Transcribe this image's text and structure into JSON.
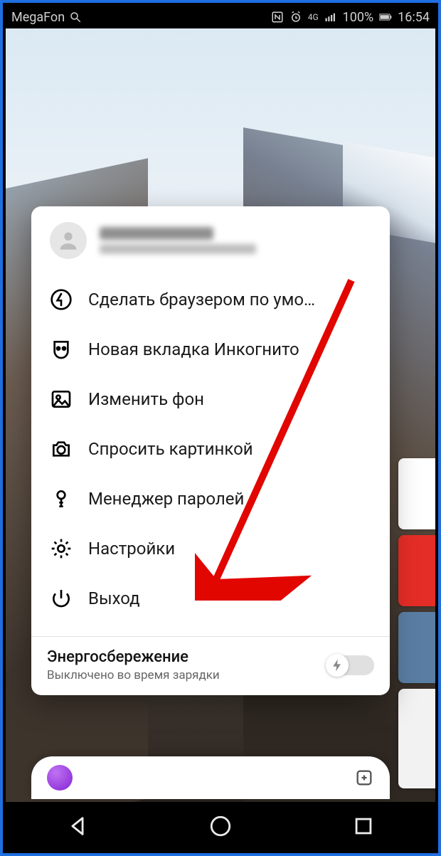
{
  "status": {
    "carrier": "MegaFon",
    "nfc_icon": "nfc-icon",
    "alarm_icon": "alarm-icon",
    "signal_label": "4G",
    "battery_pct": "100%",
    "time": "16:54"
  },
  "menu": {
    "items": [
      {
        "icon": "yandex-icon",
        "label": "Сделать браузером по умо…"
      },
      {
        "icon": "incognito-icon",
        "label": "Новая вкладка Инкогнито"
      },
      {
        "icon": "image-icon",
        "label": "Изменить фон"
      },
      {
        "icon": "camera-icon",
        "label": "Спросить картинкой"
      },
      {
        "icon": "key-icon",
        "label": "Менеджер паролей"
      },
      {
        "icon": "gear-icon",
        "label": "Настройки"
      },
      {
        "icon": "power-icon",
        "label": "Выход"
      }
    ]
  },
  "energy": {
    "title": "Энергосбережение",
    "subtitle": "Выключено во время зарядки",
    "enabled": false
  }
}
